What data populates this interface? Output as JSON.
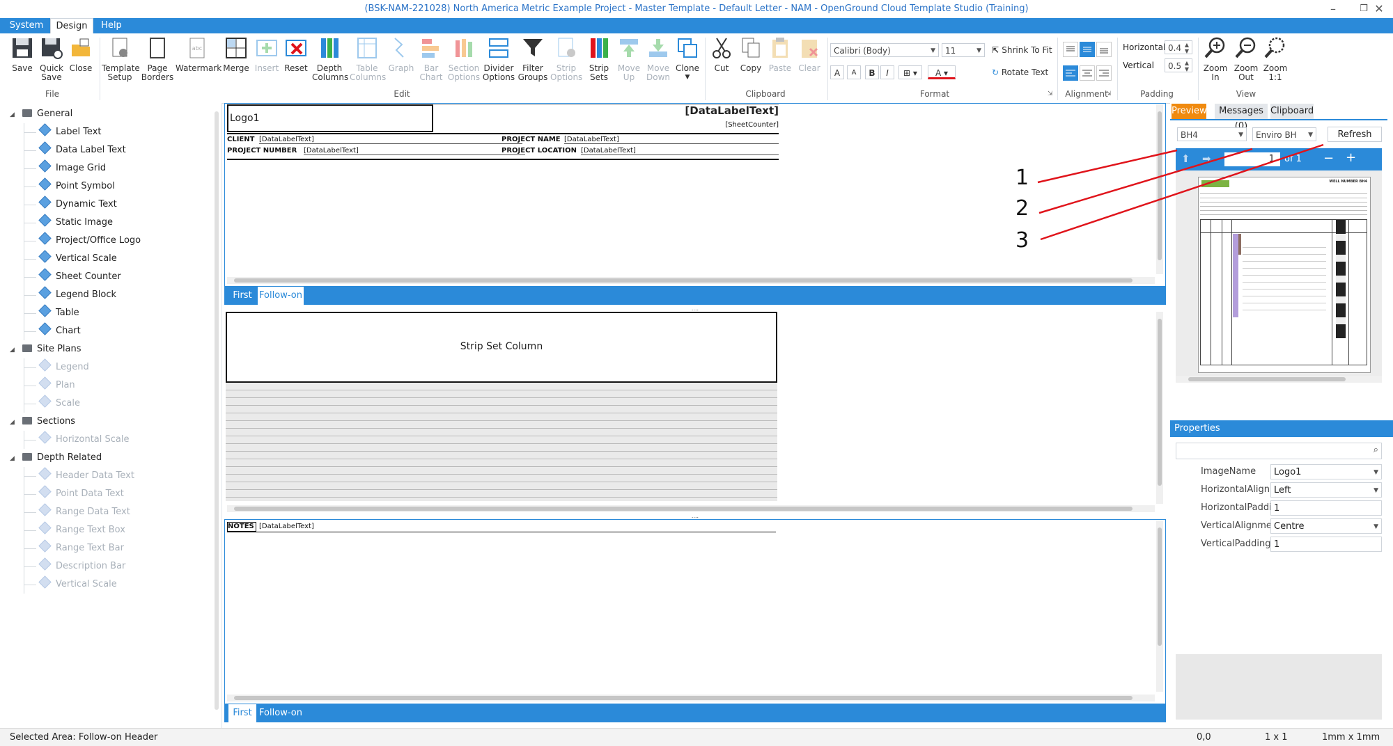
{
  "window": {
    "title": "(BSK-NAM-221028) North America Metric Example Project - Master Template - Default Letter - NAM - OpenGround Cloud Template Studio (Training)"
  },
  "menu": {
    "tabs": [
      "System",
      "Design",
      "Help"
    ]
  },
  "ribbon": {
    "file": {
      "group": "File",
      "save": "Save",
      "quick_save": [
        "Quick",
        "Save"
      ],
      "close": "Close"
    },
    "edit": {
      "group": "Edit",
      "template_setup": [
        "Template",
        "Setup"
      ],
      "page_borders": [
        "Page",
        "Borders"
      ],
      "watermark": "Watermark",
      "merge": "Merge",
      "insert": "Insert",
      "reset": "Reset",
      "depth_columns": [
        "Depth",
        "Columns"
      ],
      "table_columns": [
        "Table",
        "Columns"
      ],
      "graph": "Graph",
      "bar_chart": [
        "Bar",
        "Chart"
      ],
      "section_options": [
        "Section",
        "Options"
      ],
      "divider_options": [
        "Divider",
        "Options"
      ],
      "filter_groups": [
        "Filter",
        "Groups"
      ],
      "strip_options": [
        "Strip",
        "Options"
      ],
      "strip_sets": [
        "Strip",
        "Sets"
      ],
      "move_up": [
        "Move",
        "Up"
      ],
      "move_down": [
        "Move",
        "Down"
      ],
      "clone": "Clone"
    },
    "clipboard": {
      "group": "Clipboard",
      "cut": "Cut",
      "copy": "Copy",
      "paste": "Paste",
      "clear": "Clear"
    },
    "format": {
      "group": "Format",
      "font": "Calibri (Body)",
      "size": "11",
      "shrink": "Shrink To Fit",
      "rotate": "Rotate Text",
      "bold": "B",
      "italic": "I",
      "font_color": "A",
      "grow": "A",
      "shrink_font": "A"
    },
    "alignment": {
      "group": "Alignment"
    },
    "padding": {
      "group": "Padding",
      "horizontal_label": "Horizontal",
      "horizontal_value": "0.4",
      "vertical_label": "Vertical",
      "vertical_value": "0.5"
    },
    "view": {
      "group": "View",
      "zoom_in": [
        "Zoom",
        "In"
      ],
      "zoom_out": [
        "Zoom",
        "Out"
      ],
      "zoom_11": [
        "Zoom",
        "1:1"
      ]
    }
  },
  "tree": {
    "general": "General",
    "general_items": [
      "Label Text",
      "Data Label Text",
      "Image Grid",
      "Point Symbol",
      "Dynamic Text",
      "Static Image",
      "Project/Office Logo",
      "Vertical Scale",
      "Sheet Counter",
      "Legend Block",
      "Table",
      "Chart"
    ],
    "site_plans": "Site Plans",
    "site_items": [
      "Legend",
      "Plan",
      "Scale"
    ],
    "sections": "Sections",
    "section_items": [
      "Horizontal Scale"
    ],
    "depth_related": "Depth Related",
    "depth_items": [
      "Header Data Text",
      "Point Data Text",
      "Range Data Text",
      "Range Text Box",
      "Range Text Bar",
      "Description Bar",
      "Vertical Scale"
    ]
  },
  "header_area": {
    "logo": "Logo1",
    "data_label": "[DataLabelText]",
    "sheet_counter": "[SheetCounter]",
    "client_label": "CLIENT",
    "client_value": "[DataLabelText]",
    "project_name_label": "PROJECT NAME",
    "project_name_value": "[DataLabelText]",
    "project_number_label": "PROJECT NUMBER",
    "project_number_value": "[DataLabelText]",
    "project_location_label": "PROJECT LOCATION",
    "project_location_value": "[DataLabelText]"
  },
  "tabs": {
    "first": "First",
    "follow_on": "Follow-on"
  },
  "strip_area": {
    "column": "Strip Set Column"
  },
  "notes_area": {
    "label": "NOTES",
    "value": "[DataLabelText]"
  },
  "preview": {
    "tabs": [
      "Preview",
      "Messages (0)",
      "Clipboard"
    ],
    "bh": "BH4",
    "filter": "Enviro BH",
    "refresh": "Refresh",
    "page": "1",
    "of": "of 1",
    "minus": "−",
    "plus": "+",
    "thumb_title": "WELL NUMBER BH4"
  },
  "annotations": [
    "1",
    "2",
    "3"
  ],
  "properties": {
    "title": "Properties",
    "rows": [
      {
        "name": "ImageName",
        "value": "Logo1"
      },
      {
        "name": "HorizontalAlignme",
        "value": "Left"
      },
      {
        "name": "HorizontalPadding",
        "value": "1"
      },
      {
        "name": "VerticalAlignment",
        "value": "Centre"
      },
      {
        "name": "VerticalPadding",
        "value": "1"
      }
    ]
  },
  "status": {
    "selected": "Selected Area: Follow-on Header",
    "coords": "0,0",
    "cells": "1 x 1",
    "grid": "1mm x 1mm"
  },
  "colors": {
    "accent": "#2b8ad9",
    "preview_tab": "#f08a0f",
    "annotation": "#e0141b"
  }
}
